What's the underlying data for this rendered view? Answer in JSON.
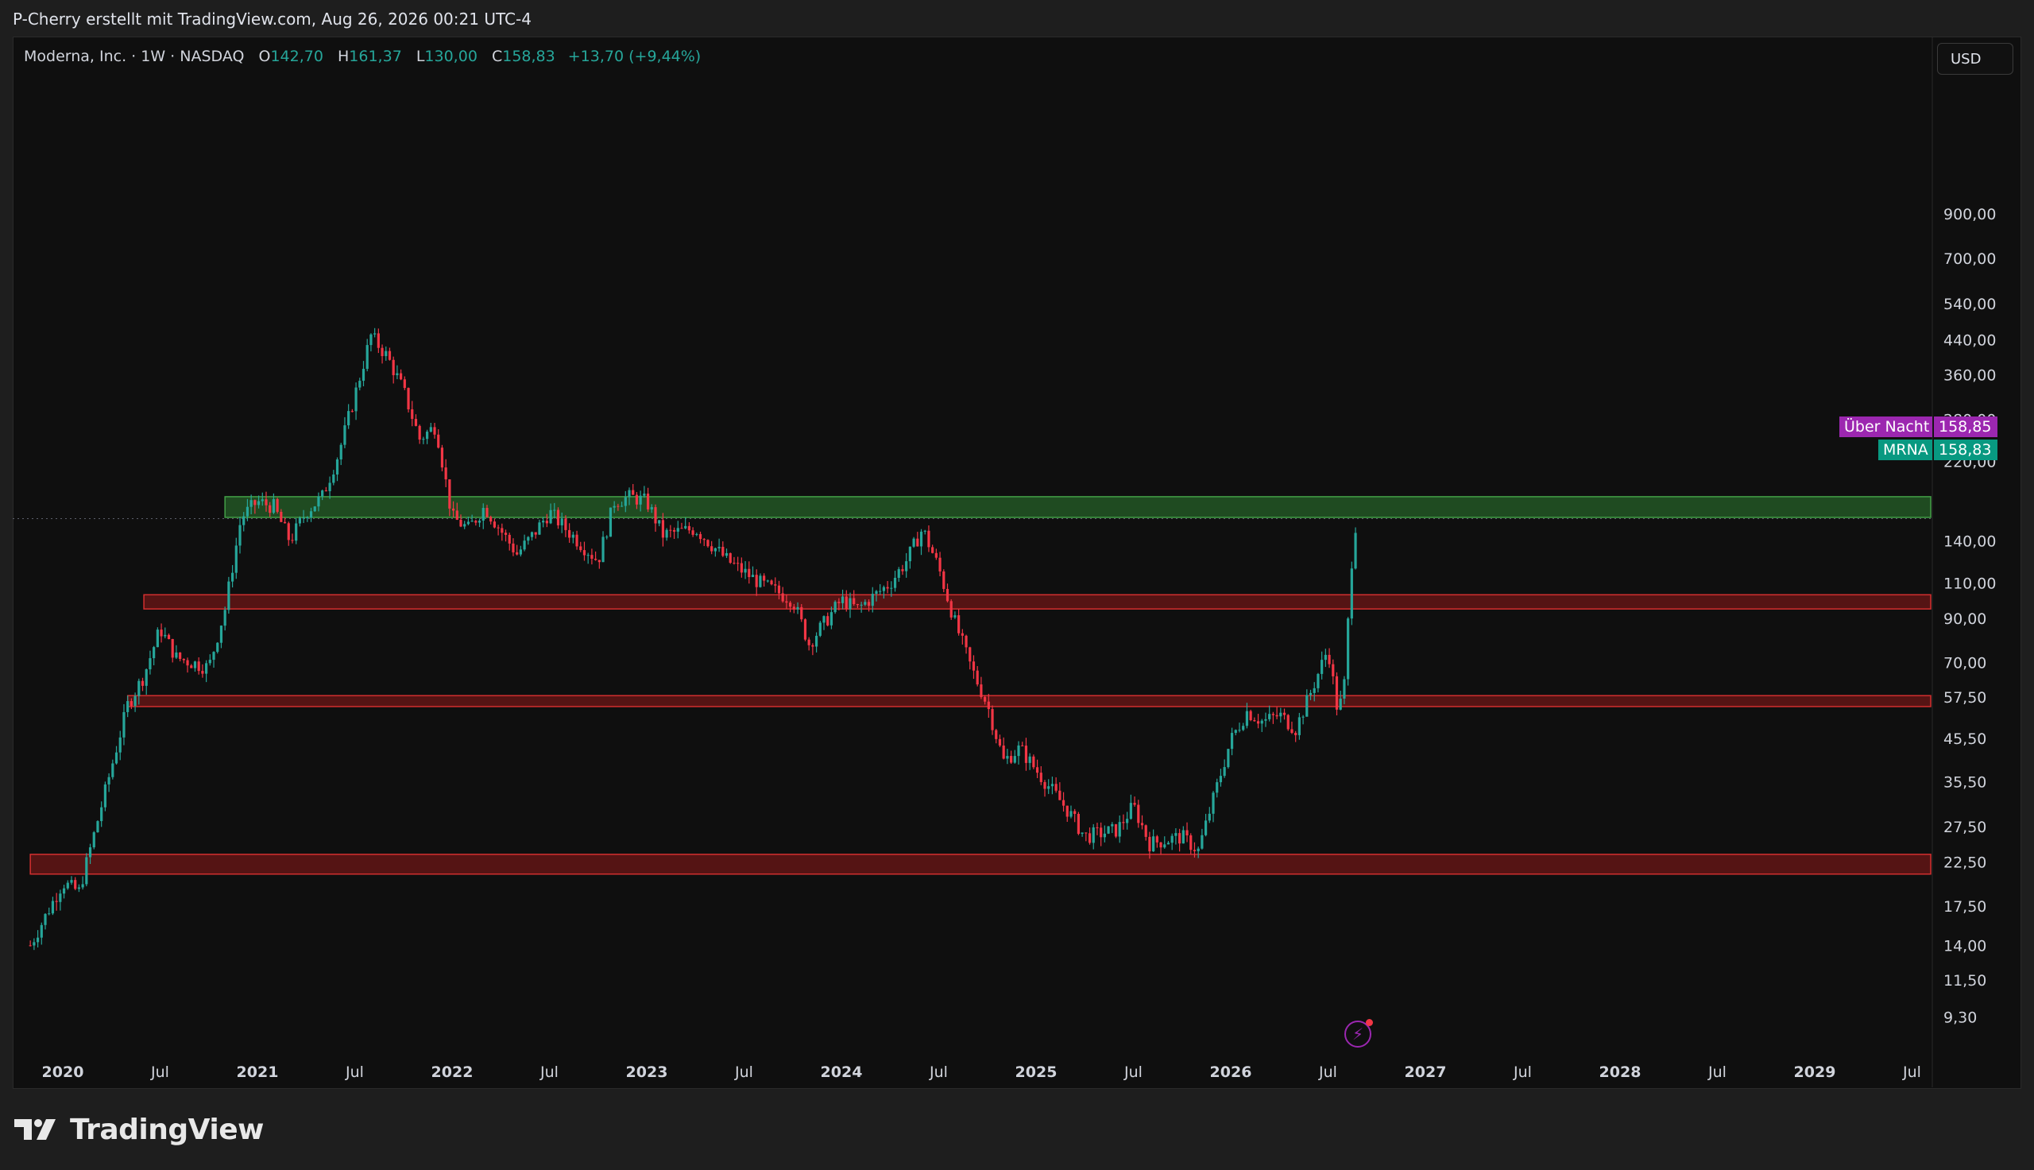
{
  "header": {
    "credit": "P-Cherry erstellt mit TradingView.com, Aug 26, 2026 00:21 UTC-4"
  },
  "legend": {
    "symbol": "Moderna, Inc. · 1W · NASDAQ",
    "open_key": "O",
    "open": "142,70",
    "high_key": "H",
    "high": "161,37",
    "low_key": "L",
    "low": "130,00",
    "close_key": "C",
    "close": "158,83",
    "change": "+13,70 (+9,44%)"
  },
  "currency": "USD",
  "tags": {
    "overnight_label": "Über Nacht",
    "overnight_value": "158,85",
    "symbol_label": "MRNA",
    "symbol_value": "158,83"
  },
  "colors": {
    "up": "#26a69a",
    "down": "#f23645",
    "overnight": "#9c27b0",
    "resistance_zone": "#2e7d32",
    "support_zone": "#b71c1c"
  },
  "footer": {
    "brand": "TradingView"
  },
  "chart_data": {
    "type": "candlestick",
    "scale": "log",
    "title": "Moderna, Inc. · 1W · NASDAQ",
    "y_ticks": [
      "900,00",
      "700,00",
      "540,00",
      "440,00",
      "360,00",
      "280,00",
      "220,00",
      "140,00",
      "110,00",
      "90,00",
      "70,00",
      "57,50",
      "45,50",
      "35,50",
      "27,50",
      "22,50",
      "17,50",
      "14,00",
      "11,50",
      "9,30"
    ],
    "x_ticks": [
      "2020",
      "Jul",
      "2021",
      "Jul",
      "2022",
      "Jul",
      "2023",
      "Jul",
      "2024",
      "Jul",
      "2025",
      "Jul",
      "2026",
      "Jul",
      "2027",
      "Jul",
      "2028",
      "Jul",
      "2029",
      "Jul"
    ],
    "x_tick_dates": [
      "2020-01",
      "2020-07",
      "2021-01",
      "2021-07",
      "2022-01",
      "2022-07",
      "2023-01",
      "2023-07",
      "2024-01",
      "2024-07",
      "2025-01",
      "2025-07",
      "2026-01",
      "2026-07",
      "2027-01",
      "2027-07",
      "2028-01",
      "2028-07",
      "2029-01",
      "2029-07"
    ],
    "last_price": 158.83,
    "overnight_price": 158.85,
    "zones": [
      {
        "kind": "resistance",
        "low": 160,
        "high": 180,
        "from": "2020-11",
        "to": "2029-12"
      },
      {
        "kind": "support",
        "low": 95,
        "high": 103,
        "from": "2020-06",
        "to": "2029-12"
      },
      {
        "kind": "support",
        "low": 54.5,
        "high": 58,
        "from": "2020-05",
        "to": "2029-12"
      },
      {
        "kind": "support",
        "low": 21,
        "high": 23.5,
        "from": "2019-11",
        "to": "2029-12"
      }
    ],
    "price_path": [
      [
        "2019-11",
        14
      ],
      [
        "2020-01",
        20
      ],
      [
        "2020-02",
        19
      ],
      [
        "2020-03",
        27
      ],
      [
        "2020-05",
        55
      ],
      [
        "2020-06",
        65
      ],
      [
        "2020-07",
        85
      ],
      [
        "2020-08",
        72
      ],
      [
        "2020-10",
        68
      ],
      [
        "2020-11",
        95
      ],
      [
        "2020-12",
        160
      ],
      [
        "2021-01",
        175
      ],
      [
        "2021-02",
        170
      ],
      [
        "2021-03",
        140
      ],
      [
        "2021-04",
        165
      ],
      [
        "2021-05",
        180
      ],
      [
        "2021-06",
        230
      ],
      [
        "2021-07",
        320
      ],
      [
        "2021-08",
        450
      ],
      [
        "2021-09",
        400
      ],
      [
        "2021-10",
        330
      ],
      [
        "2021-11",
        250
      ],
      [
        "2021-12",
        270
      ],
      [
        "2022-01",
        160
      ],
      [
        "2022-02",
        150
      ],
      [
        "2022-03",
        170
      ],
      [
        "2022-05",
        130
      ],
      [
        "2022-06",
        145
      ],
      [
        "2022-07",
        165
      ],
      [
        "2022-08",
        150
      ],
      [
        "2022-10",
        125
      ],
      [
        "2022-11",
        175
      ],
      [
        "2022-12",
        180
      ],
      [
        "2023-01",
        175
      ],
      [
        "2023-02",
        145
      ],
      [
        "2023-04",
        150
      ],
      [
        "2023-06",
        125
      ],
      [
        "2023-08",
        110
      ],
      [
        "2023-10",
        100
      ],
      [
        "2023-11",
        78
      ],
      [
        "2024-01",
        100
      ],
      [
        "2024-02",
        95
      ],
      [
        "2024-04",
        110
      ],
      [
        "2024-05",
        125
      ],
      [
        "2024-06",
        150
      ],
      [
        "2024-07",
        120
      ],
      [
        "2024-08",
        88
      ],
      [
        "2024-09",
        68
      ],
      [
        "2024-10",
        55
      ],
      [
        "2024-11",
        40
      ],
      [
        "2024-12",
        43
      ],
      [
        "2025-01",
        38
      ],
      [
        "2025-03",
        30
      ],
      [
        "2025-04",
        26
      ],
      [
        "2025-06",
        27
      ],
      [
        "2025-07",
        31
      ],
      [
        "2025-08",
        25
      ],
      [
        "2025-10",
        26
      ],
      [
        "2025-11",
        24
      ],
      [
        "2025-12",
        33
      ],
      [
        "2026-01",
        45
      ],
      [
        "2026-02",
        53
      ],
      [
        "2026-03",
        50
      ],
      [
        "2026-04",
        52
      ],
      [
        "2026-05",
        48
      ],
      [
        "2026-06",
        60
      ],
      [
        "2026-07",
        76
      ],
      [
        "2026-07-20",
        52
      ],
      [
        "2026-08",
        62
      ],
      [
        "2026-08-18",
        145
      ],
      [
        "2026-08-25",
        158.83
      ]
    ]
  }
}
